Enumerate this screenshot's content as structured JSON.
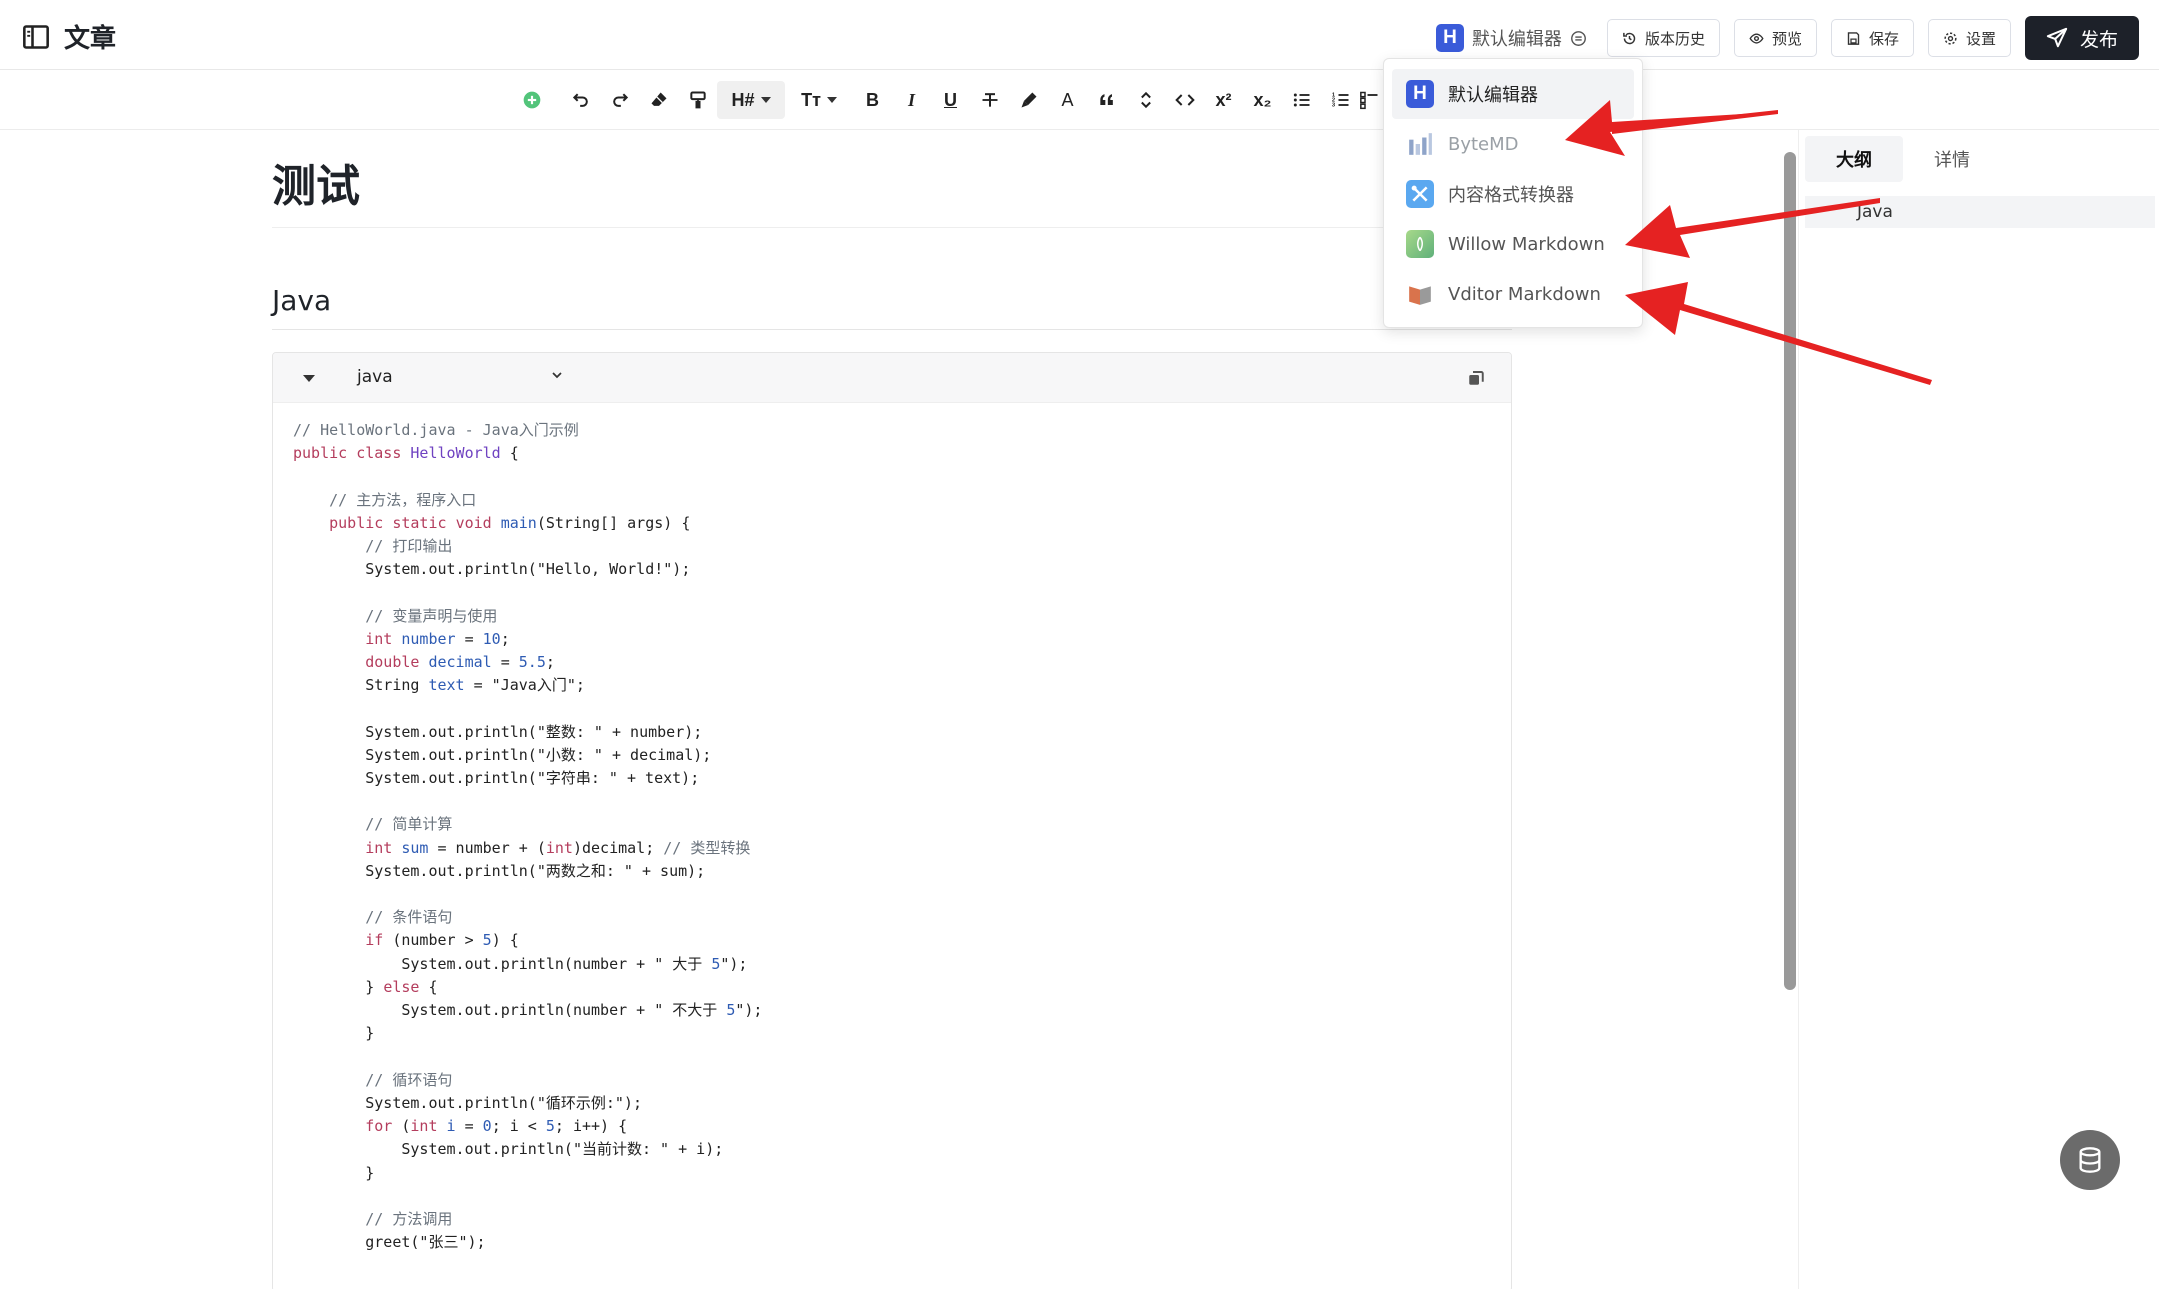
{
  "header": {
    "title": "文章",
    "editor_current": "默认编辑器",
    "editor_logo_letter": "H",
    "buttons": {
      "history": "版本历史",
      "preview": "预览",
      "save": "保存",
      "settings": "设置",
      "publish": "发布"
    }
  },
  "toolbar": {
    "heading_label": "H#",
    "textsize_label": "Tт",
    "bold": "B",
    "italic": "I",
    "underline": "U",
    "font_color": "A",
    "superscript": "x²",
    "subscript": "x₂"
  },
  "article": {
    "title": "测试",
    "heading": "Java",
    "code_language": "java"
  },
  "code_lines": [
    "// HelloWorld.java - Java入门示例",
    "public class HelloWorld {",
    "",
    "    // 主方法，程序入口",
    "    public static void main(String[] args) {",
    "        // 打印输出",
    "        System.out.println(\"Hello, World!\");",
    "",
    "        // 变量声明与使用",
    "        int number = 10;",
    "        double decimal = 5.5;",
    "        String text = \"Java入门\";",
    "",
    "        System.out.println(\"整数: \" + number);",
    "        System.out.println(\"小数: \" + decimal);",
    "        System.out.println(\"字符串: \" + text);",
    "",
    "        // 简单计算",
    "        int sum = number + (int)decimal; // 类型转换",
    "        System.out.println(\"两数之和: \" + sum);",
    "",
    "        // 条件语句",
    "        if (number > 5) {",
    "            System.out.println(number + \" 大于 5\");",
    "        } else {",
    "            System.out.println(number + \" 不大于 5\");",
    "        }",
    "",
    "        // 循环语句",
    "        System.out.println(\"循环示例:\");",
    "        for (int i = 0; i < 5; i++) {",
    "            System.out.println(\"当前计数: \" + i);",
    "        }",
    "",
    "        // 方法调用",
    "        greet(\"张三\");"
  ],
  "right_panel": {
    "tabs": [
      "大纲",
      "详情"
    ],
    "outline": [
      "Java"
    ]
  },
  "dropdown": {
    "items": [
      {
        "label": "默认编辑器",
        "icon": "h-logo-icon",
        "color": "#3a5bd9"
      },
      {
        "label": "ByteMD",
        "icon": "bytemd-icon",
        "color": "#9fb3d6"
      },
      {
        "label": "内容格式转换器",
        "icon": "converter-icon",
        "color": "#5aa8f0"
      },
      {
        "label": "Willow Markdown",
        "icon": "willow-icon",
        "color": "#7cc47a"
      },
      {
        "label": "Vditor Markdown",
        "icon": "vditor-icon",
        "color": "#d9734c"
      }
    ]
  },
  "colors": {
    "accent": "#3a5bd9",
    "publish_bg": "#1d2129",
    "arrow": "#e52222"
  }
}
